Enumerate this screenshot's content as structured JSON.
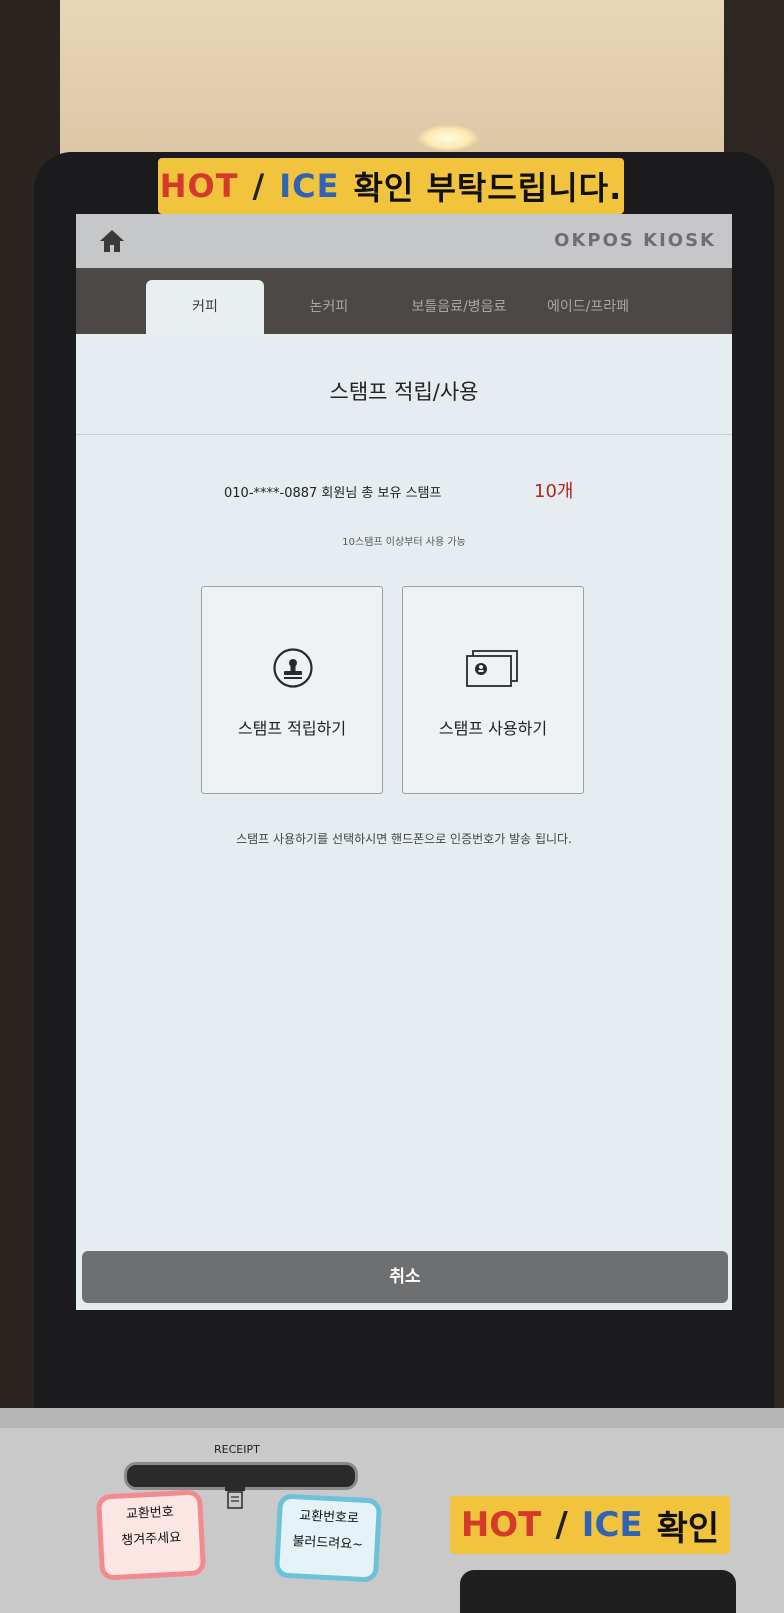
{
  "top_sticker": {
    "hot": "HOT",
    "slash": "/",
    "ice": "ICE",
    "text": "확인 부탁드립니다."
  },
  "header": {
    "brand": "OKPOS KIOSK"
  },
  "tabs": [
    {
      "label": "커피",
      "active": true
    },
    {
      "label": "논커피",
      "active": false
    },
    {
      "label": "보틀음료/병음료",
      "active": false
    },
    {
      "label": "에이드/프라페",
      "active": false
    }
  ],
  "stamp": {
    "title": "스탬프 적립/사용",
    "member_text": "010-****-0887 회원님 총 보유 스탬프",
    "count": "10개",
    "min_note": "10스탬프 이상부터 사용 가능",
    "earn_label": "스탬프 적립하기",
    "use_label": "스탬프 사용하기",
    "notice": "스탬프 사용하기를 선택하시면 핸드폰으로 인증번호가 발송 됩니다."
  },
  "cancel_label": "취소",
  "base": {
    "receipt_label": "RECEIPT",
    "note_left": [
      "교환번호",
      "챙겨주세요"
    ],
    "note_right": [
      "교환번호로",
      "불러드려요~"
    ],
    "bottom_sticker": {
      "hot": "HOT",
      "slash": "/",
      "ice": "ICE",
      "text": "확인"
    }
  },
  "colors": {
    "accent_red": "#b5241f",
    "sticker_yellow": "#f2c33c",
    "hot_red": "#d43a2a",
    "ice_blue": "#2e63b6"
  },
  "icons": {
    "home": "home-icon",
    "earn": "stamp-icon",
    "use": "stamp-cards-icon",
    "receipt": "receipt-icon"
  }
}
